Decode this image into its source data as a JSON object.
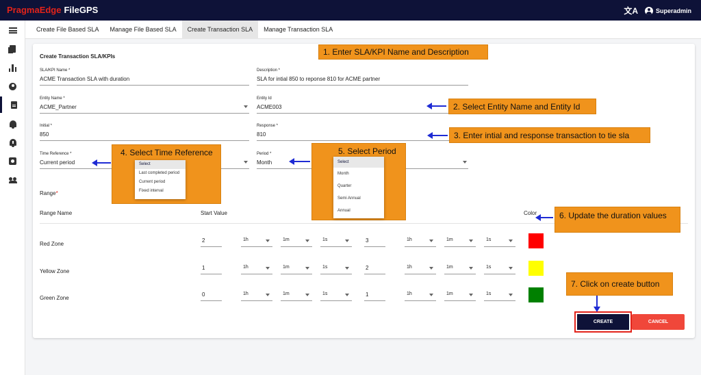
{
  "app": {
    "brand_part1": "PragmaEdge",
    "brand_part2": "FileGPS",
    "user": "Superadmin",
    "lang_icon": "translate-icon"
  },
  "tabs": [
    {
      "label": "Create File Based SLA"
    },
    {
      "label": "Manage File Based SLA"
    },
    {
      "label": "Create Transaction SLA",
      "active": true
    },
    {
      "label": "Manage Transaction SLA"
    }
  ],
  "sidebar": {
    "icons": [
      "menu-icon",
      "documents-icon",
      "bar-chart-icon",
      "account-icon",
      "document-icon",
      "bell-icon",
      "alert-bell-icon",
      "settings-box-icon",
      "group-icon"
    ],
    "active_index": 4
  },
  "form": {
    "title": "Create Transaction SLA/KPIs",
    "sla_name": {
      "label": "SLA/KPI Name *",
      "value": "ACME Transaction SLA with duration"
    },
    "description": {
      "label": "Description *",
      "value": "SLA for intial 850 to reponse 810 for ACME partner"
    },
    "entity_name": {
      "label": "Entity Name *",
      "value": "ACME_Partner"
    },
    "entity_id": {
      "label": "Entity Id",
      "value": "ACME003"
    },
    "initial": {
      "label": "Initial *",
      "value": "850"
    },
    "response": {
      "label": "Response *",
      "value": "810"
    },
    "time_reference": {
      "label": "Time Reference *",
      "value": "Current period",
      "options": [
        "Select",
        "Last completed period",
        "Current period",
        "Fixed interval"
      ]
    },
    "period": {
      "label": "Period *",
      "value": "Month",
      "options": [
        "Select",
        "Month",
        "Quarter",
        "Semi Annual",
        "Annual"
      ]
    }
  },
  "range": {
    "title": "Range",
    "required_mark": "*",
    "headers": {
      "name": "Range Name",
      "start": "Start Value",
      "color": "Color"
    },
    "rows": [
      {
        "name": "Red Zone",
        "start": "2",
        "start_h": "1h",
        "start_m": "1m",
        "start_s": "1s",
        "end": "3",
        "end_h": "1h",
        "end_m": "1m",
        "end_s": "1s",
        "color": "#ff0000"
      },
      {
        "name": "Yellow Zone",
        "start": "1",
        "start_h": "1h",
        "start_m": "1m",
        "start_s": "1s",
        "end": "2",
        "end_h": "1h",
        "end_m": "1m",
        "end_s": "1s",
        "color": "#ffff00"
      },
      {
        "name": "Green Zone",
        "start": "0",
        "start_h": "1h",
        "start_m": "1m",
        "start_s": "1s",
        "end": "1",
        "end_h": "1h",
        "end_m": "1m",
        "end_s": "1s",
        "color": "#008000"
      }
    ]
  },
  "buttons": {
    "create": "CREATE",
    "cancel": "CANCEL"
  },
  "annotations": {
    "step1": "1. Enter SLA/KPI Name and Description",
    "step2": "2. Select Entity Name and Entity Id",
    "step3": "3. Enter intial and response transaction to tie sla",
    "step4": "4. Select Time Reference",
    "step5": "5. Select Period",
    "step6": "6. Update the duration values",
    "step7": "7. Click on create button",
    "callout_color": "#f0931c",
    "arrow_color": "#1e2bd4"
  }
}
